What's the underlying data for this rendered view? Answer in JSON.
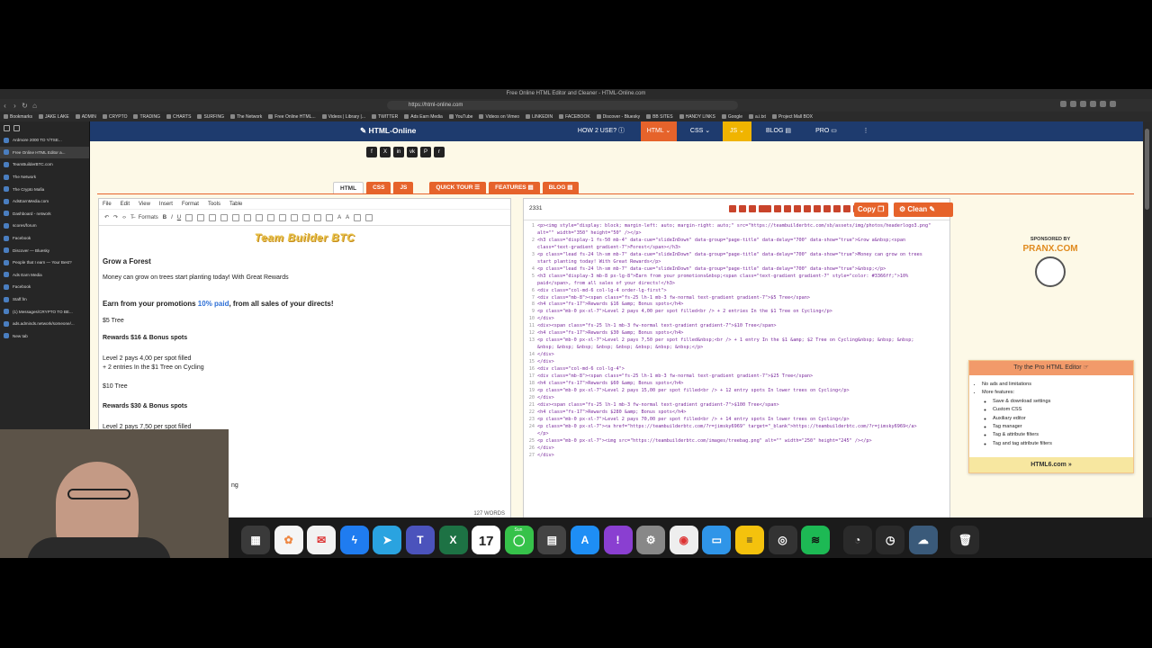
{
  "window": {
    "title": "Free Online HTML Editor and Cleaner - HTML-Online.com",
    "url": "https://html-online.com"
  },
  "bookmarks": [
    "Bookmarks",
    "JAKE LAKE",
    "ADMIN",
    "CRYPTO",
    "TRADING",
    "CHARTS",
    "SURFING",
    "The Network",
    "Free Online HTML...",
    "Videos | Library |...",
    "TWITTER",
    "Ads Earn Media",
    "YouTube",
    "Videos on Vimeo",
    "LINKEDIN",
    "FACEBOOK",
    "Discover - Bluesky",
    "BB SITES",
    "HANDY LINKS",
    "Google",
    "a.i.txt",
    "Project Mall BOX"
  ],
  "sidebar": {
    "items": [
      "Ardmore 2000 TD Y/TSE...",
      "Free Online HTML Editor a...",
      "TeamBuilderBTC.com",
      "The Network",
      "The Crypto Mafia",
      "AdsEarnMedia.com",
      "Dashboard - network",
      "scores/forum",
      "Facebook",
      "Discover — Bluesky",
      "People that I earn — Your Best?",
      "Ads Earn Media",
      "Facebook",
      "Staff.fm",
      "(1) Messages/CRYPTO TO BE...",
      "ads.adminds.network/someone/...",
      "New tab"
    ]
  },
  "site": {
    "logo": "HTML-Online",
    "nav": [
      "HOW 2 USE?",
      "HTML",
      "CSS",
      "JS",
      "BLOG",
      "PRO"
    ],
    "tabs": [
      "HTML",
      "CSS",
      "JS",
      "QUICK TOUR",
      "FEATURES",
      "BLOG"
    ]
  },
  "editor": {
    "menu": [
      "File",
      "Edit",
      "View",
      "Insert",
      "Format",
      "Tools",
      "Table"
    ],
    "formats_label": "Formats",
    "banner": "Team Builder BTC",
    "content": {
      "h1": "Grow a Forest",
      "p1": "Money can grow on trees start planting today! With Great Rewards",
      "h2a": "Earn from your promotions ",
      "h2b": "10% paid",
      "h2c": ", from all sales of your directs!",
      "p2": "$5 Tree",
      "h3": "Rewards $16 & Bonus spots",
      "p3a": "Level 2 pays 4,00 per spot filled",
      "p3b": "+ 2 entries In the $1 Tree on Cycling",
      "p4": "$10 Tree",
      "h4": "Rewards $30 & Bonus spots",
      "p5a": "Level 2 pays 7,50 per spot filled",
      "p5b": "+ 1 entry In the $1 & $2 Tree on Cycling",
      "tail": "ng"
    },
    "word_count": "127 WORDS"
  },
  "code": {
    "char_count": "2331",
    "copy_label": "Copy",
    "clean_label": "Clean",
    "lines": [
      "<p><img style=\"display: block; margin-left: auto; margin-right: auto;\" src=\"https://teambuilderbtc.com/sb/assets/img/photos/headerlogo3.png\"",
      "alt=\"\" width=\"350\" height=\"50\" /></p>",
      "<h3 class=\"display-1 fs-50 mb-4\" data-cue=\"slideInDown\" data-group=\"page-title\" data-delay=\"700\" data-show=\"true\">Grow a&nbsp;<span",
      "class=\"text-gradient gradient-7\">Forest</span></h3>",
      "<p class=\"lead fs-24 lh-sm mb-7\" data-cue=\"slideInDown\" data-group=\"page-title\" data-delay=\"700\" data-show=\"true\">Money can grow on trees",
      "start planting today! With Great Rewards</p>",
      "<p class=\"lead fs-24 lh-sm mb-7\" data-cue=\"slideInDown\" data-group=\"page-title\" data-delay=\"700\" data-show=\"true\">&nbsp;</p>",
      "<h3 class=\"display-3 mb-8 px-lg-8\">Earn from your promotions&nbsp;<span class=\"text-gradient gradient-7\" style=\"color: #3366ff;\">10%",
      "paid</span>, from all sales of your directs!</h3>",
      "<div class=\"col-md-6 col-lg-4 order-lg-first\">",
      "<div class=\"mb-8\"><span class=\"fs-25 lh-1 mb-3 fw-normal text-gradient gradient-7\">$5 Tree</span>",
      "<h4 class=\"fs-17\">Rewards $16 &amp; Bonus spots</h4>",
      "<p class=\"mb-0 px-xl-7\">Level 2 pays 4,00 per spot filled<br /> + 2 entries In the $1 Tree on Cycling</p>",
      "</div>",
      "<div><span class=\"fs-25 lh-1 mb-3 fw-normal text-gradient gradient-7\">$10 Tree</span>",
      "<h4 class=\"fs-17\">Rewards $30 &amp; Bonus spots</h4>",
      "<p class=\"mb-0 px-xl-7\">Level 2 pays 7,50 per spot filled&nbsp;<br /> + 1 entry In the $1 &amp; $2 Tree on Cycling&nbsp; &nbsp; &nbsp;",
      "&nbsp; &nbsp; &nbsp; &nbsp; &nbsp; &nbsp; &nbsp; &nbsp;</p>",
      "</div>",
      "</div>",
      "<div class=\"col-md-6 col-lg-4\">",
      "<div class=\"mb-8\"><span class=\"fs-25 lh-1 mb-3 fw-normal text-gradient gradient-7\">$25 Tree</span>",
      "<h4 class=\"fs-17\">Rewards $60 &amp; Bonus spots</h4>",
      "<p class=\"mb-0 px-xl-7\">Level 2 pays 15,00 per spot filled<br /> + 12 entry spots In lower trees on Cycling</p>",
      "</div>",
      "<div><span class=\"fs-25 lh-1 mb-3 fw-normal text-gradient gradient-7\">$100 Tree</span>",
      "<h4 class=\"fs-17\">Rewards $280 &amp; Bonus spots</h4>",
      "<p class=\"mb-0 px-xl-7\">Level 2 pays 70,00 per spot filled<br /> + 14 entry spots In lower trees on Cycling</p>",
      "<p class=\"mb-0 px-xl-7\"><a href=\"https://teambuilderbtc.com/?r=jimsky6969\" target=\"_blank\">https://teambuilderbtc.com/?r=jimsky6969</a>",
      "</p>",
      "<p class=\"mb-0 px-xl-7\"><img src=\"https://teambuilderbtc.com/images/treebag.png\" alt=\"\" width=\"250\" height=\"245\" /></p>",
      "</div>",
      "</div>"
    ],
    "line_numbers": [
      "1",
      "",
      "2",
      "",
      "3",
      "",
      "4",
      "5",
      "",
      "6",
      "7",
      "8",
      "9",
      "10",
      "11",
      "12",
      "13",
      "",
      "14",
      "15",
      "16",
      "17",
      "18",
      "19",
      "20",
      "21",
      "22",
      "23",
      "24",
      "",
      "25",
      "26",
      "27"
    ]
  },
  "sponsor": {
    "label": "SPONSORED BY",
    "brand": "PRANX.COM"
  },
  "promo": {
    "title": "Try the Pro HTML Editor",
    "items": [
      "No ads and limitations",
      "More features:"
    ],
    "features": [
      "Save & download settings",
      "Custom CSS",
      "Auxiliary editor",
      "Tag manager",
      "Tag & attribute filters",
      "Tag and tag attribute filters"
    ],
    "cta": "HTML6.com »"
  },
  "dock": {
    "calendar_month": "Sun",
    "calendar_day": "17"
  }
}
